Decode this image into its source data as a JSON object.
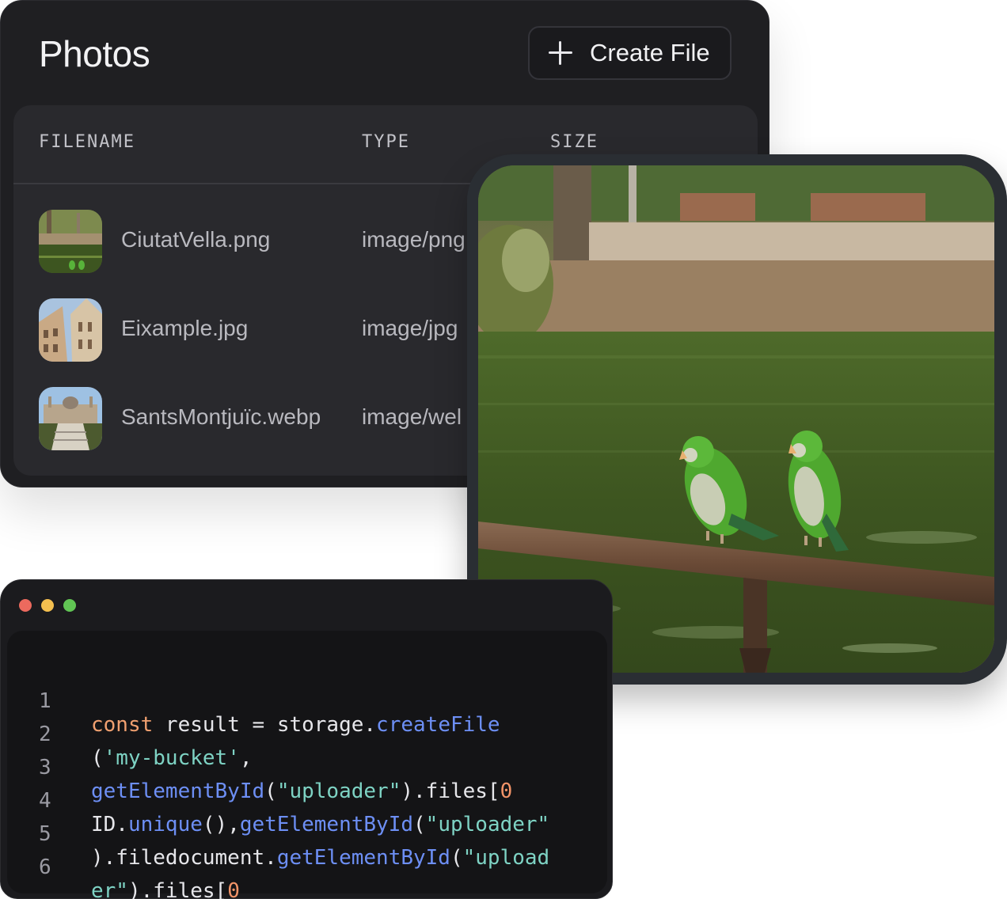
{
  "photos": {
    "title": "Photos",
    "create_button": {
      "label": "Create File",
      "icon": "plus-icon"
    },
    "columns": [
      "FILENAME",
      "TYPE",
      "SIZE"
    ],
    "files": [
      {
        "name": "CiutatVella.png",
        "type": "image/png",
        "thumb": "park-lake-thumbnail"
      },
      {
        "name": "Eixample.jpg",
        "type": "image/jpg",
        "thumb": "building-facade-thumbnail"
      },
      {
        "name": "SantsMontjuïc.webp",
        "type": "image/wel",
        "thumb": "palace-thumbnail"
      }
    ]
  },
  "preview": {
    "image": "parrots-on-railing-photo",
    "colors": {
      "water": "#3f5a24",
      "parrot": "#4fa82f",
      "railing": "#6a4a36"
    }
  },
  "editor": {
    "window_controls": [
      "close",
      "minimize",
      "maximize"
    ],
    "lines": [
      {
        "n": "1",
        "tokens": [
          {
            "t": "kw",
            "v": "const"
          },
          {
            "t": "plain",
            "v": " result = storage."
          },
          {
            "t": "fn",
            "v": "createFile"
          }
        ]
      },
      {
        "n": "2",
        "tokens": [
          {
            "t": "plain",
            "v": "("
          },
          {
            "t": "str",
            "v": "'my-bucket'"
          },
          {
            "t": "plain",
            "v": ","
          }
        ]
      },
      {
        "n": "3",
        "tokens": [
          {
            "t": "fn",
            "v": "getElementById"
          },
          {
            "t": "plain",
            "v": "("
          },
          {
            "t": "str",
            "v": "\"uploader\""
          },
          {
            "t": "plain",
            "v": ").files["
          },
          {
            "t": "num",
            "v": "0"
          }
        ]
      },
      {
        "n": "4",
        "tokens": [
          {
            "t": "plain",
            "v": "ID."
          },
          {
            "t": "fn",
            "v": "unique"
          },
          {
            "t": "plain",
            "v": "(),"
          },
          {
            "t": "fn",
            "v": "getElementById"
          },
          {
            "t": "plain",
            "v": "("
          },
          {
            "t": "str",
            "v": "\"uploader\""
          }
        ]
      },
      {
        "n": "5",
        "tokens": [
          {
            "t": "plain",
            "v": ").filedocument."
          },
          {
            "t": "fn",
            "v": "getElementById"
          },
          {
            "t": "plain",
            "v": "("
          },
          {
            "t": "str",
            "v": "\"upload"
          }
        ]
      },
      {
        "n": "6",
        "tokens": [
          {
            "t": "str",
            "v": "er\""
          },
          {
            "t": "plain",
            "v": ").files["
          },
          {
            "t": "num",
            "v": "0"
          }
        ]
      }
    ]
  }
}
